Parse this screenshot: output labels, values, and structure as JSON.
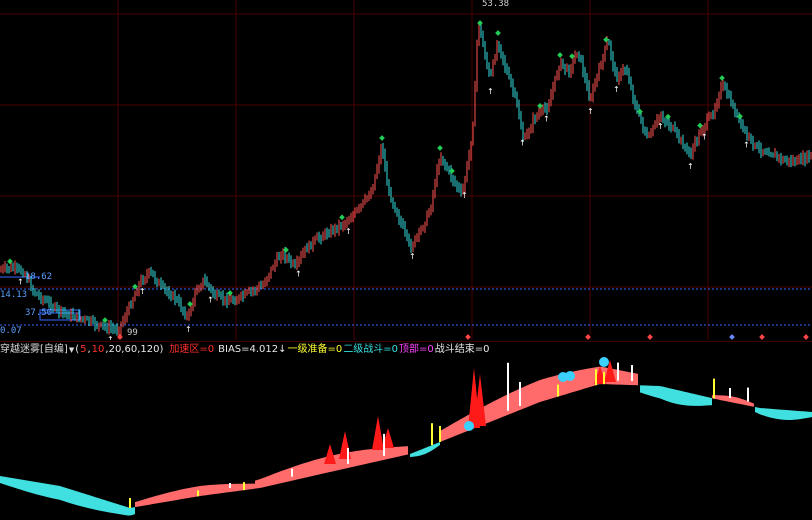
{
  "price_labels": {
    "high": "53.38",
    "level_a": "18.62",
    "level_b": "14.13",
    "level_c": "37.50",
    "level_d": "0.07",
    "low": "99"
  },
  "indicator": {
    "name": "穿越迷雾[自编]",
    "params_open": "(",
    "p1": "5",
    "sep1": ",",
    "p2": "10",
    "rest": ",20,60,120)",
    "zone_label": "加速区=0",
    "bias_label": "BIAS=4.012↓",
    "level1_label": "一级准备=0",
    "level2_label": "二级战斗=0",
    "top_label": "顶部=0",
    "end_label": "战斗结束=0"
  },
  "colors": {
    "up_candle": "#ff5555",
    "down_candle": "#33e0e0",
    "buy_marker": "#22cc55",
    "sell_marker": "#ffffff",
    "ribbon_up": "#ff6a6a",
    "ribbon_down": "#40e0e0",
    "spike_red": "#ff1a1a",
    "spike_yellow": "#ffff33",
    "spike_white": "#ffffff",
    "circle_marker": "#3ad0ff",
    "grid": "#5a0000",
    "guide_line": "#3a6aff"
  }
}
